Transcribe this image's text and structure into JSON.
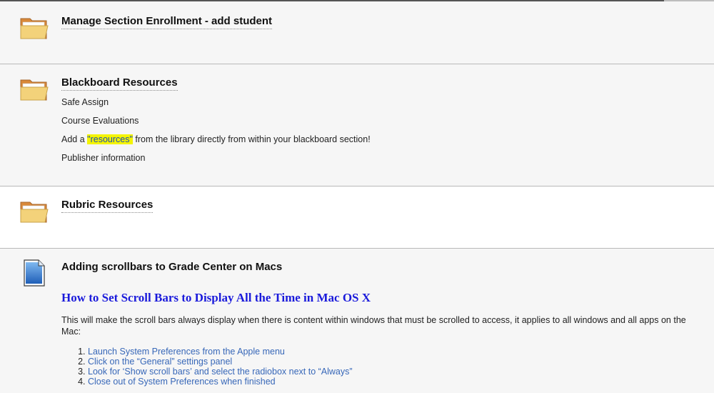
{
  "items": [
    {
      "title": "Manage Section Enrollment - add student",
      "icon": "folder-icon"
    },
    {
      "title": "Blackboard Resources",
      "icon": "folder-icon",
      "lines": [
        "Safe Assign",
        "Course Evaluations",
        "Publisher information"
      ],
      "add_line": {
        "before": "Add a ",
        "highlight": "\"resources\"",
        "after": " from the library directly from within your blackboard section!"
      }
    },
    {
      "title": "Rubric Resources",
      "icon": "folder-icon"
    },
    {
      "title": "Adding scrollbars to Grade Center on Macs",
      "icon": "document-icon",
      "link": "How to Set Scroll Bars to Display All the Time in Mac OS X",
      "description": "This will make the scroll bars always display when there is content within windows that must be scrolled to access, it applies to all windows and all apps on the Mac:",
      "steps": [
        "Launch System Preferences from the  Apple menu",
        "Click on the “General” settings panel",
        "Look for ‘Show scroll bars’ and select the radiobox next to “Always”",
        "Close out of System Preferences when finished"
      ]
    }
  ],
  "colors": {
    "link": "#1a1adb",
    "step_link": "#3767b8",
    "highlight": "#f4f400",
    "item_background": "#f6f6f6",
    "divider": "#b9b9b9"
  }
}
